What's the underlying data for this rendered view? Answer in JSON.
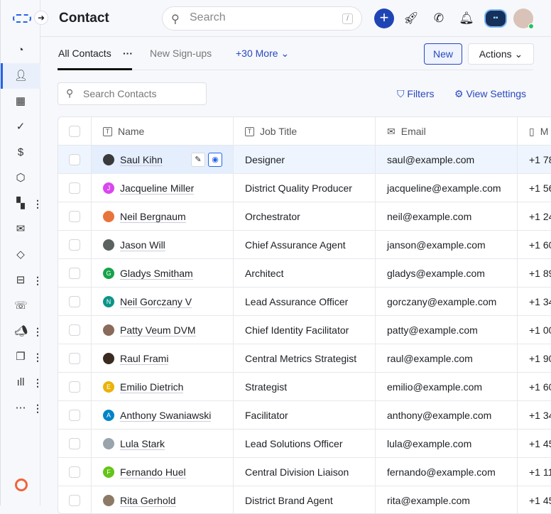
{
  "header": {
    "title": "Contact",
    "search_placeholder": "Search",
    "search_shortcut": "/"
  },
  "tabs": {
    "all": "All Contacts",
    "all_menu": "···",
    "new_signups": "New Sign-ups",
    "more": "+30 More"
  },
  "buttons": {
    "new": "New",
    "actions": "Actions",
    "filters": "Filters",
    "view_settings": "View Settings"
  },
  "contact_search_placeholder": "Search Contacts",
  "columns": {
    "name": "Name",
    "job": "Job Title",
    "email": "Email",
    "phone": "M"
  },
  "colors": {
    "accent": "#2848c0",
    "selected_row": "#eff5fe"
  },
  "rows": [
    {
      "name": "Saul Kihn",
      "job": "Designer",
      "email": "saul@example.com",
      "phone": "+1 78",
      "initial": "",
      "color": "#3a3a3a"
    },
    {
      "name": "Jacqueline Miller",
      "job": "District Quality Producer",
      "email": "jacqueline@example.com",
      "phone": "+1 56",
      "initial": "J",
      "color": "#d946ef"
    },
    {
      "name": "Neil Bergnaum",
      "job": "Orchestrator",
      "email": "neil@example.com",
      "phone": "+1 24",
      "initial": "",
      "color": "#e8743b"
    },
    {
      "name": "Jason Will",
      "job": "Chief Assurance Agent",
      "email": "janson@example.com",
      "phone": "+1 60",
      "initial": "",
      "color": "#5b6360"
    },
    {
      "name": "Gladys Smitham",
      "job": "Architect",
      "email": "gladys@example.com",
      "phone": "+1 89",
      "initial": "G",
      "color": "#16a34a"
    },
    {
      "name": "Neil Gorczany V",
      "job": "Lead Assurance Officer",
      "email": "gorczany@example.com",
      "phone": "+1 34",
      "initial": "N",
      "color": "#0d9488"
    },
    {
      "name": "Patty Veum DVM",
      "job": "Chief Identity Facilitator",
      "email": "patty@example.com",
      "phone": "+1 00",
      "initial": "",
      "color": "#8a6a5a"
    },
    {
      "name": "Raul Frami",
      "job": "Central Metrics Strategist",
      "email": "raul@example.com",
      "phone": "+1 90",
      "initial": "",
      "color": "#3b2a20"
    },
    {
      "name": "Emilio Dietrich",
      "job": "Strategist",
      "email": "emilio@example.com",
      "phone": "+1 60",
      "initial": "E",
      "color": "#eab308"
    },
    {
      "name": "Anthony Swaniawski",
      "job": "Facilitator",
      "email": "anthony@example.com",
      "phone": "+1 34",
      "initial": "A",
      "color": "#0284c7"
    },
    {
      "name": "Lula Stark",
      "job": "Lead Solutions Officer",
      "email": "lula@example.com",
      "phone": "+1 45",
      "initial": "",
      "color": "#9aa4ad"
    },
    {
      "name": "Fernando Huel",
      "job": "Central Division Liaison",
      "email": "fernando@example.com",
      "phone": "+1 11",
      "initial": "F",
      "color": "#65c418"
    },
    {
      "name": "Rita Gerhold",
      "job": "District Brand Agent",
      "email": "rita@example.com",
      "phone": "+1 45",
      "initial": "",
      "color": "#8d7a66"
    }
  ],
  "sidebar": [
    "dashboard-icon",
    "contacts-icon",
    "companies-icon",
    "tasks-icon",
    "deals-icon",
    "products-icon",
    "apps-icon",
    "email-icon",
    "tickets-icon",
    "inbox-icon",
    "calls-icon",
    "campaigns-icon",
    "conversations-icon",
    "reports-icon",
    "more-icon"
  ]
}
